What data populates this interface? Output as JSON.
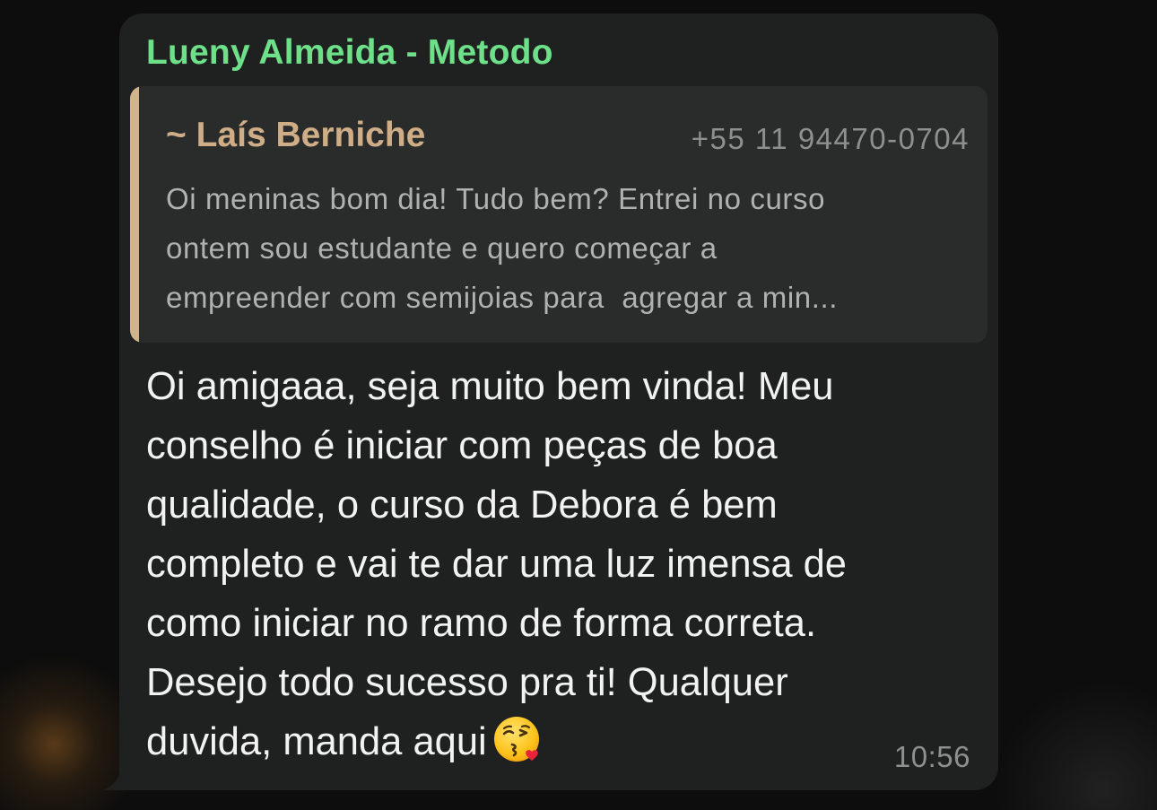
{
  "message": {
    "sender_name": "Lueny Almeida - Metodo",
    "quoted": {
      "author": "~ Laís Berniche",
      "phone": "+55 11 94470-0704",
      "lines": [
        "Oi meninas bom dia! Tudo bem? Entrei no curso",
        "ontem sou estudante e quero começar a",
        "empreender com semijoias para  agregar a min..."
      ]
    },
    "body_lines": [
      "Oi amigaaa, seja muito bem vinda! Meu",
      "conselho é iniciar com peças de boa",
      "qualidade, o curso da Debora é bem",
      "completo e vai te dar uma luz imensa de",
      "como iniciar no ramo de forma correta.",
      "Desejo todo sucesso pra ti! Qualquer",
      "duvida, manda aqui"
    ],
    "emoji": "kissing-face-with-heart-emoji",
    "time": "10:56"
  },
  "colors": {
    "bubble": "#1f2020",
    "sender": "#6fe08a",
    "quote_accent": "#d2b48c",
    "quote_author": "#cfae87",
    "muted": "#8e8f8f"
  }
}
